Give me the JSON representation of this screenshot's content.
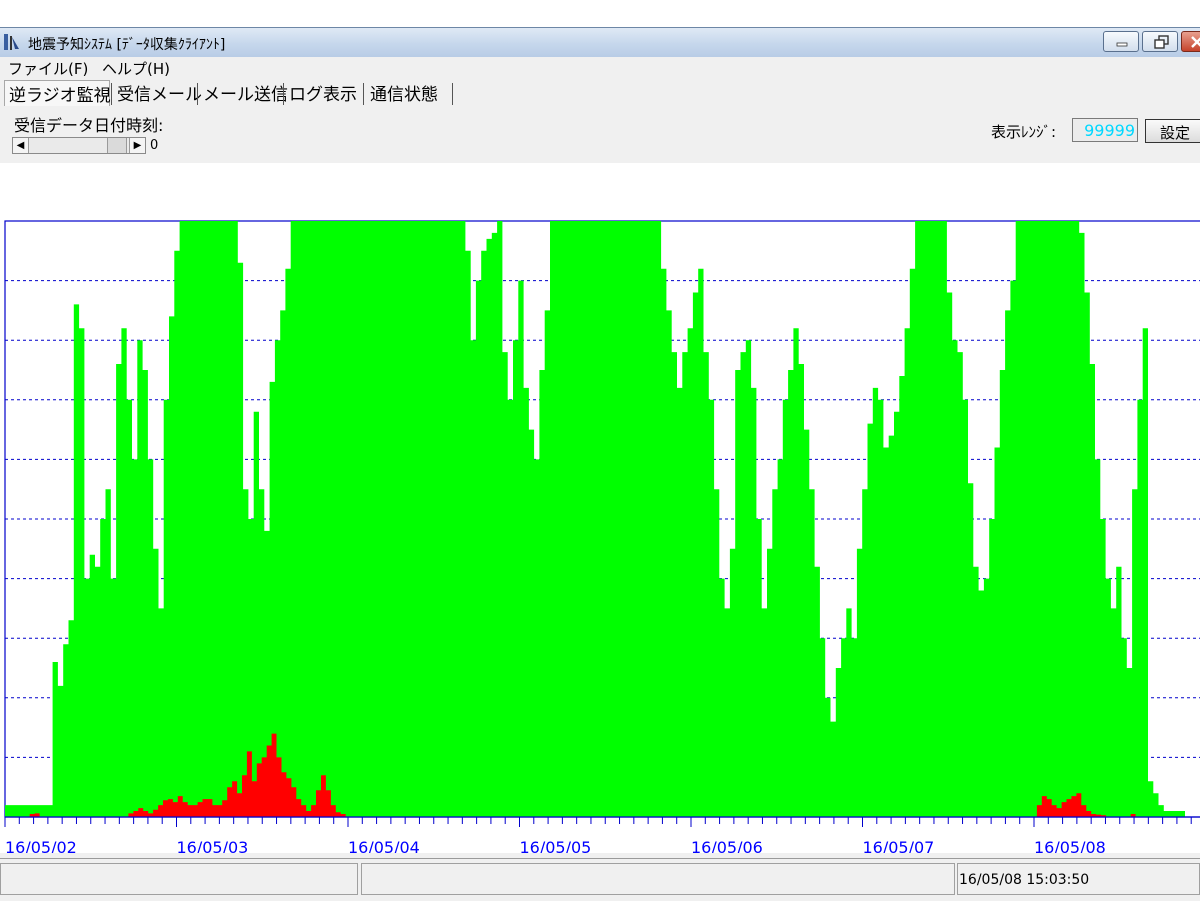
{
  "window": {
    "title": "地震予知ｼｽﾃﾑ [ﾃﾞｰﾀ収集ｸﾗｲｱﾝﾄ]"
  },
  "menu": [
    {
      "label": "ファイル(F)"
    },
    {
      "label": "ヘルプ(H)"
    }
  ],
  "tabs": [
    {
      "label": "逆ラジオ監視",
      "active": true
    },
    {
      "label": "受信メール",
      "active": false
    },
    {
      "label": "メール送信",
      "active": false
    },
    {
      "label": "ログ表示",
      "active": false
    },
    {
      "label": "通信状態",
      "active": false
    }
  ],
  "controls": {
    "received_label": "受信データ日付時刻:",
    "slider_value": "0",
    "range_label": "表示ﾚﾝｼﾞ:",
    "range_value": "99999",
    "set_button": "設定"
  },
  "chart_data": {
    "type": "area",
    "x_ticks": [
      "16/05/02",
      "16/05/03",
      "16/05/04",
      "16/05/05",
      "16/05/06",
      "16/05/07",
      "16/05/08"
    ],
    "grid": true,
    "colors": {
      "primary": "#00ff00",
      "secondary": "#ff0000",
      "grid": "#0000cc",
      "axis_text": "#0000ff"
    },
    "series": [
      {
        "values": [
          0.02,
          0.02,
          0.02,
          0.02,
          0.02,
          0.02,
          0.02,
          0.02,
          0.02,
          0.26,
          0.22,
          0.29,
          0.33,
          0.86,
          0.82,
          0.4,
          0.44,
          0.42,
          0.5,
          0.55,
          0.4,
          0.76,
          0.82,
          0.7,
          0.6,
          0.8,
          0.75,
          0.6,
          0.45,
          0.35,
          0.7,
          0.84,
          0.95,
          1,
          1,
          1,
          1,
          1,
          1,
          1,
          1,
          1,
          1,
          1,
          0.93,
          0.55,
          0.5,
          0.68,
          0.55,
          0.48,
          0.73,
          0.8,
          0.85,
          0.92,
          1,
          1,
          1,
          1,
          1,
          1,
          1,
          1,
          1,
          1,
          1,
          1,
          1,
          1,
          1,
          1,
          1,
          1,
          1,
          1,
          1,
          1,
          1,
          1,
          1,
          1,
          1,
          1,
          1,
          1,
          1,
          1,
          1,
          0.95,
          0.8,
          0.9,
          0.95,
          0.97,
          0.98,
          1,
          0.78,
          0.7,
          0.8,
          0.9,
          0.72,
          0.65,
          0.6,
          0.75,
          0.85,
          1,
          1,
          1,
          1,
          1,
          1,
          1,
          1,
          1,
          1,
          1,
          1,
          1,
          1,
          1,
          1,
          1,
          1,
          1,
          1,
          1,
          0.92,
          0.85,
          0.78,
          0.72,
          0.78,
          0.82,
          0.88,
          0.92,
          0.78,
          0.7,
          0.55,
          0.4,
          0.35,
          0.45,
          0.75,
          0.78,
          0.8,
          0.72,
          0.5,
          0.35,
          0.45,
          0.55,
          0.6,
          0.7,
          0.75,
          0.82,
          0.76,
          0.65,
          0.55,
          0.42,
          0.3,
          0.2,
          0.16,
          0.25,
          0.3,
          0.35,
          0.3,
          0.45,
          0.55,
          0.66,
          0.72,
          0.7,
          0.62,
          0.64,
          0.68,
          0.74,
          0.82,
          0.92,
          1,
          1,
          1,
          1,
          1,
          1,
          0.88,
          0.8,
          0.78,
          0.7,
          0.56,
          0.42,
          0.38,
          0.4,
          0.5,
          0.62,
          0.75,
          0.85,
          0.9,
          1,
          1,
          1,
          1,
          1,
          1,
          1,
          1,
          1,
          1,
          1,
          1,
          0.98,
          0.88,
          0.76,
          0.6,
          0.5,
          0.4,
          0.35,
          0.42,
          0.3,
          0.25,
          0.55,
          0.7,
          0.82,
          0.06,
          0.04,
          0.02,
          0.01,
          0.01,
          0.01,
          0.01
        ]
      },
      {
        "values": [
          0,
          0,
          0,
          0,
          0,
          0.005,
          0.006,
          0,
          0,
          0,
          0,
          0,
          0,
          0,
          0,
          0,
          0,
          0,
          0,
          0,
          0,
          0,
          0,
          0,
          0,
          0.006,
          0.01,
          0.015,
          0.01,
          0.006,
          0.012,
          0.02,
          0.028,
          0.03,
          0.025,
          0.035,
          0.025,
          0.02,
          0.02,
          0.025,
          0.03,
          0.03,
          0.02,
          0.02,
          0.028,
          0.05,
          0.06,
          0.04,
          0.07,
          0.11,
          0.06,
          0.09,
          0.1,
          0.12,
          0.14,
          0.1,
          0.075,
          0.065,
          0.05,
          0.03,
          0.02,
          0.01,
          0.02,
          0.045,
          0.07,
          0.045,
          0.02,
          0.008,
          0.005,
          0,
          0,
          0,
          0,
          0,
          0,
          0,
          0,
          0,
          0,
          0,
          0,
          0,
          0,
          0,
          0,
          0,
          0,
          0,
          0,
          0,
          0,
          0,
          0,
          0,
          0,
          0,
          0,
          0,
          0,
          0,
          0,
          0,
          0,
          0,
          0,
          0,
          0,
          0,
          0,
          0,
          0,
          0,
          0,
          0,
          0,
          0,
          0,
          0,
          0,
          0,
          0,
          0,
          0,
          0,
          0,
          0,
          0,
          0,
          0,
          0,
          0,
          0,
          0,
          0,
          0,
          0,
          0,
          0,
          0,
          0,
          0,
          0,
          0,
          0,
          0,
          0,
          0,
          0,
          0,
          0,
          0,
          0,
          0,
          0,
          0,
          0,
          0,
          0,
          0,
          0,
          0,
          0,
          0,
          0,
          0,
          0,
          0,
          0,
          0,
          0,
          0,
          0,
          0,
          0,
          0,
          0,
          0,
          0,
          0,
          0,
          0,
          0,
          0,
          0,
          0,
          0,
          0,
          0,
          0,
          0,
          0,
          0,
          0,
          0,
          0,
          0,
          0,
          0,
          0,
          0,
          0,
          0,
          0,
          0,
          0,
          0,
          0,
          0,
          0,
          0.02,
          0.035,
          0.03,
          0.02,
          0.015,
          0.025,
          0.03,
          0.035,
          0.04,
          0.02,
          0.01,
          0.005,
          0.004,
          0.003,
          0,
          0,
          0,
          0,
          0,
          0.005,
          0,
          0,
          0,
          0,
          0,
          0,
          0,
          0,
          0,
          0
        ]
      }
    ]
  },
  "status": {
    "timestamp": "16/05/08 15:03:50"
  }
}
